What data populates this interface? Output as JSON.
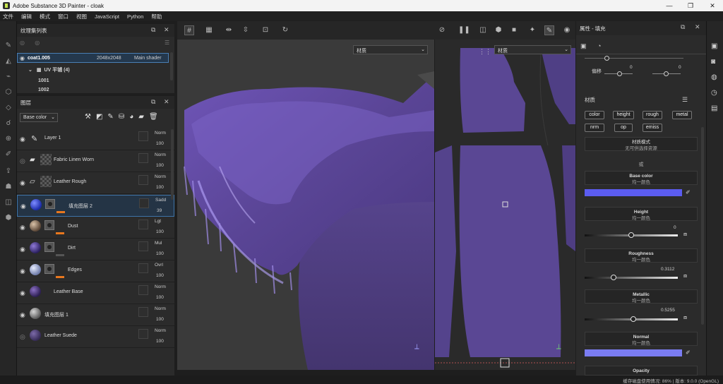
{
  "window": {
    "title": "Adobe Substance 3D Painter - cloak"
  },
  "menu": [
    "文件",
    "编辑",
    "模式",
    "窗口",
    "视图",
    "JavaScript",
    "Python",
    "帮助"
  ],
  "texture_set_panel": {
    "title": "纹理集列表",
    "rows": [
      {
        "name": "coat1.005",
        "size": "2048x2048",
        "shader": "Main shader"
      },
      {
        "name": "UV 平铺 (4)"
      },
      {
        "name": "1001"
      },
      {
        "name": "1002"
      }
    ]
  },
  "layers_panel": {
    "title": "图层",
    "channel": "Base color",
    "layers": [
      {
        "name": "Layer 1",
        "blend": "Norm",
        "opacity": "100"
      },
      {
        "name": "Fabric Linen Worn",
        "blend": "Norm",
        "opacity": "100"
      },
      {
        "name": "Leather Rough",
        "blend": "Norm",
        "opacity": "100"
      },
      {
        "name": "填充图层 2",
        "blend": "Sadd",
        "opacity": "39"
      },
      {
        "name": "Dust",
        "blend": "Lgt",
        "opacity": "100"
      },
      {
        "name": "Dirt",
        "blend": "Mul",
        "opacity": "100"
      },
      {
        "name": "Edges",
        "blend": "Ovrl",
        "opacity": "100"
      },
      {
        "name": "Leather Base",
        "blend": "Norm",
        "opacity": "100"
      },
      {
        "name": "填充图层 1",
        "blend": "Norm",
        "opacity": "100"
      },
      {
        "name": "Leather Suede",
        "blend": "Norm",
        "opacity": "100"
      }
    ]
  },
  "viewport": {
    "material_dropdown": "材质",
    "uv_material_dropdown": "材质"
  },
  "properties_panel": {
    "title": "属性 - 填充",
    "offset_label": "偏移",
    "offset_values": [
      "0",
      "0"
    ],
    "material_label": "材质",
    "channels": [
      "color",
      "height",
      "rough",
      "metal",
      "nrm",
      "op",
      "emiss"
    ],
    "material_mode": "材质模式",
    "material_mode_value": "无可供选择资源",
    "or_label": "或",
    "base_color": {
      "label": "Base color",
      "sub": "均一颜色",
      "color": "#5b5cf0"
    },
    "height": {
      "label": "Height",
      "sub": "均一颜色",
      "value": "0",
      "level": 0.5
    },
    "roughness": {
      "label": "Roughness",
      "sub": "均一颜色",
      "value": "0.3112",
      "level": 0.3112
    },
    "metallic": {
      "label": "Metallic",
      "sub": "均一颜色",
      "value": "0.5255",
      "level": 0.5255
    },
    "normal": {
      "label": "Normal",
      "sub": "均一颜色",
      "color": "#7a7cf2"
    },
    "opacity": {
      "label": "Opacity"
    }
  },
  "status": {
    "text": "缓存磁盘使用情况: 86% | 版本: 9.0.0 (OpenGL)"
  }
}
